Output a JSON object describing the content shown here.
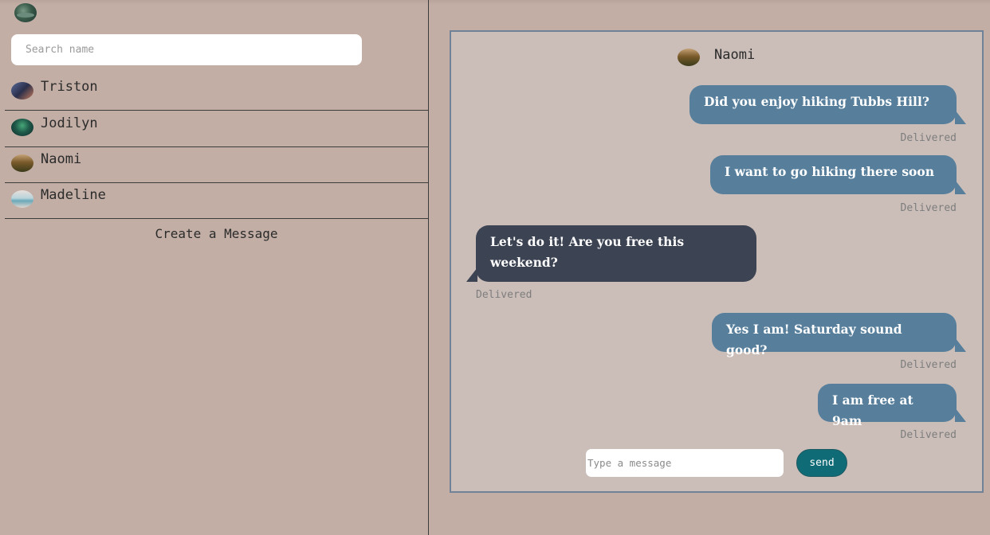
{
  "sidebar": {
    "search_placeholder": "Search name",
    "contacts": [
      {
        "name": "Triston"
      },
      {
        "name": "Jodilyn"
      },
      {
        "name": "Naomi"
      },
      {
        "name": "Madeline"
      }
    ],
    "create_label": "Create a Message"
  },
  "chat": {
    "contact_name": "Naomi",
    "messages": [
      {
        "direction": "outgoing",
        "text": "Did you enjoy hiking Tubbs Hill?",
        "status": "Delivered"
      },
      {
        "direction": "outgoing",
        "text": "I want to go hiking there soon",
        "status": "Delivered"
      },
      {
        "direction": "incoming",
        "text": "Let's do it! Are you free this weekend?",
        "status": "Delivered"
      },
      {
        "direction": "outgoing",
        "text": "Yes I am! Saturday sound good?",
        "status": "Delivered"
      },
      {
        "direction": "outgoing",
        "text": "I am free at 9am",
        "status": "Delivered"
      }
    ],
    "composer_placeholder": "Type a message",
    "send_label": "send"
  },
  "colors": {
    "background": "#c2aea5",
    "chat_background": "#cbbeb9",
    "outgoing_bubble": "#577f9c",
    "incoming_bubble": "#3c4352",
    "send_button": "#0f6b75"
  }
}
